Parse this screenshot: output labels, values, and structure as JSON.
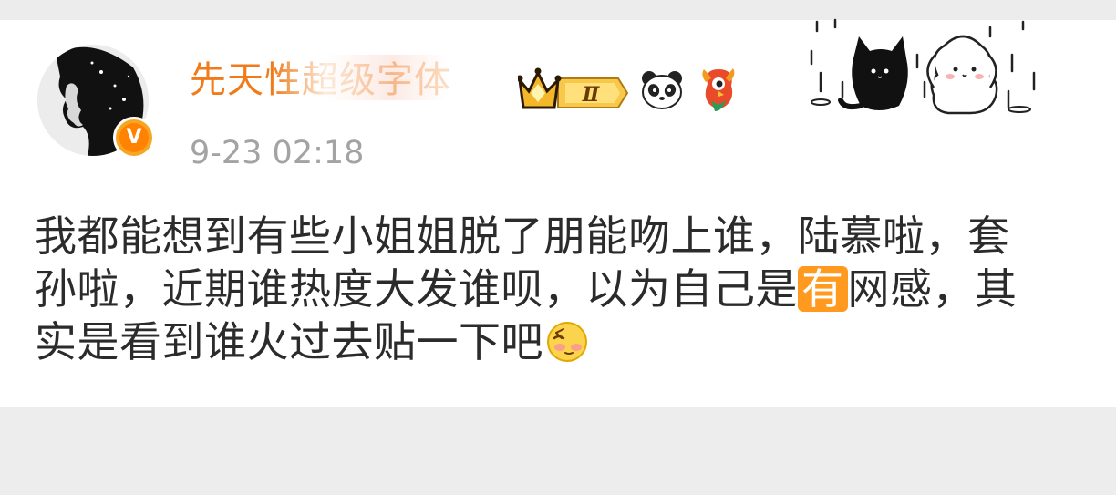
{
  "post": {
    "username": "先天性超级字体",
    "level_badge": "Ⅱ",
    "timestamp": "9-23 02:18",
    "content": {
      "line1": "我都能想到有些小姐姐脱了朋能吻上谁，陆慕啦，套",
      "line2_a": "孙啦，近期谁热度大发谁呗，以为自己是",
      "line2_highlight": "有",
      "line2_b": "网感，其",
      "line3": "实是看到谁火过去贴一下吧"
    },
    "icons": [
      "avatar",
      "verified-badge",
      "crown-level-badge",
      "panda-icon",
      "phoenix-icon",
      "cats-sticker",
      "sleepy-emoji"
    ]
  }
}
